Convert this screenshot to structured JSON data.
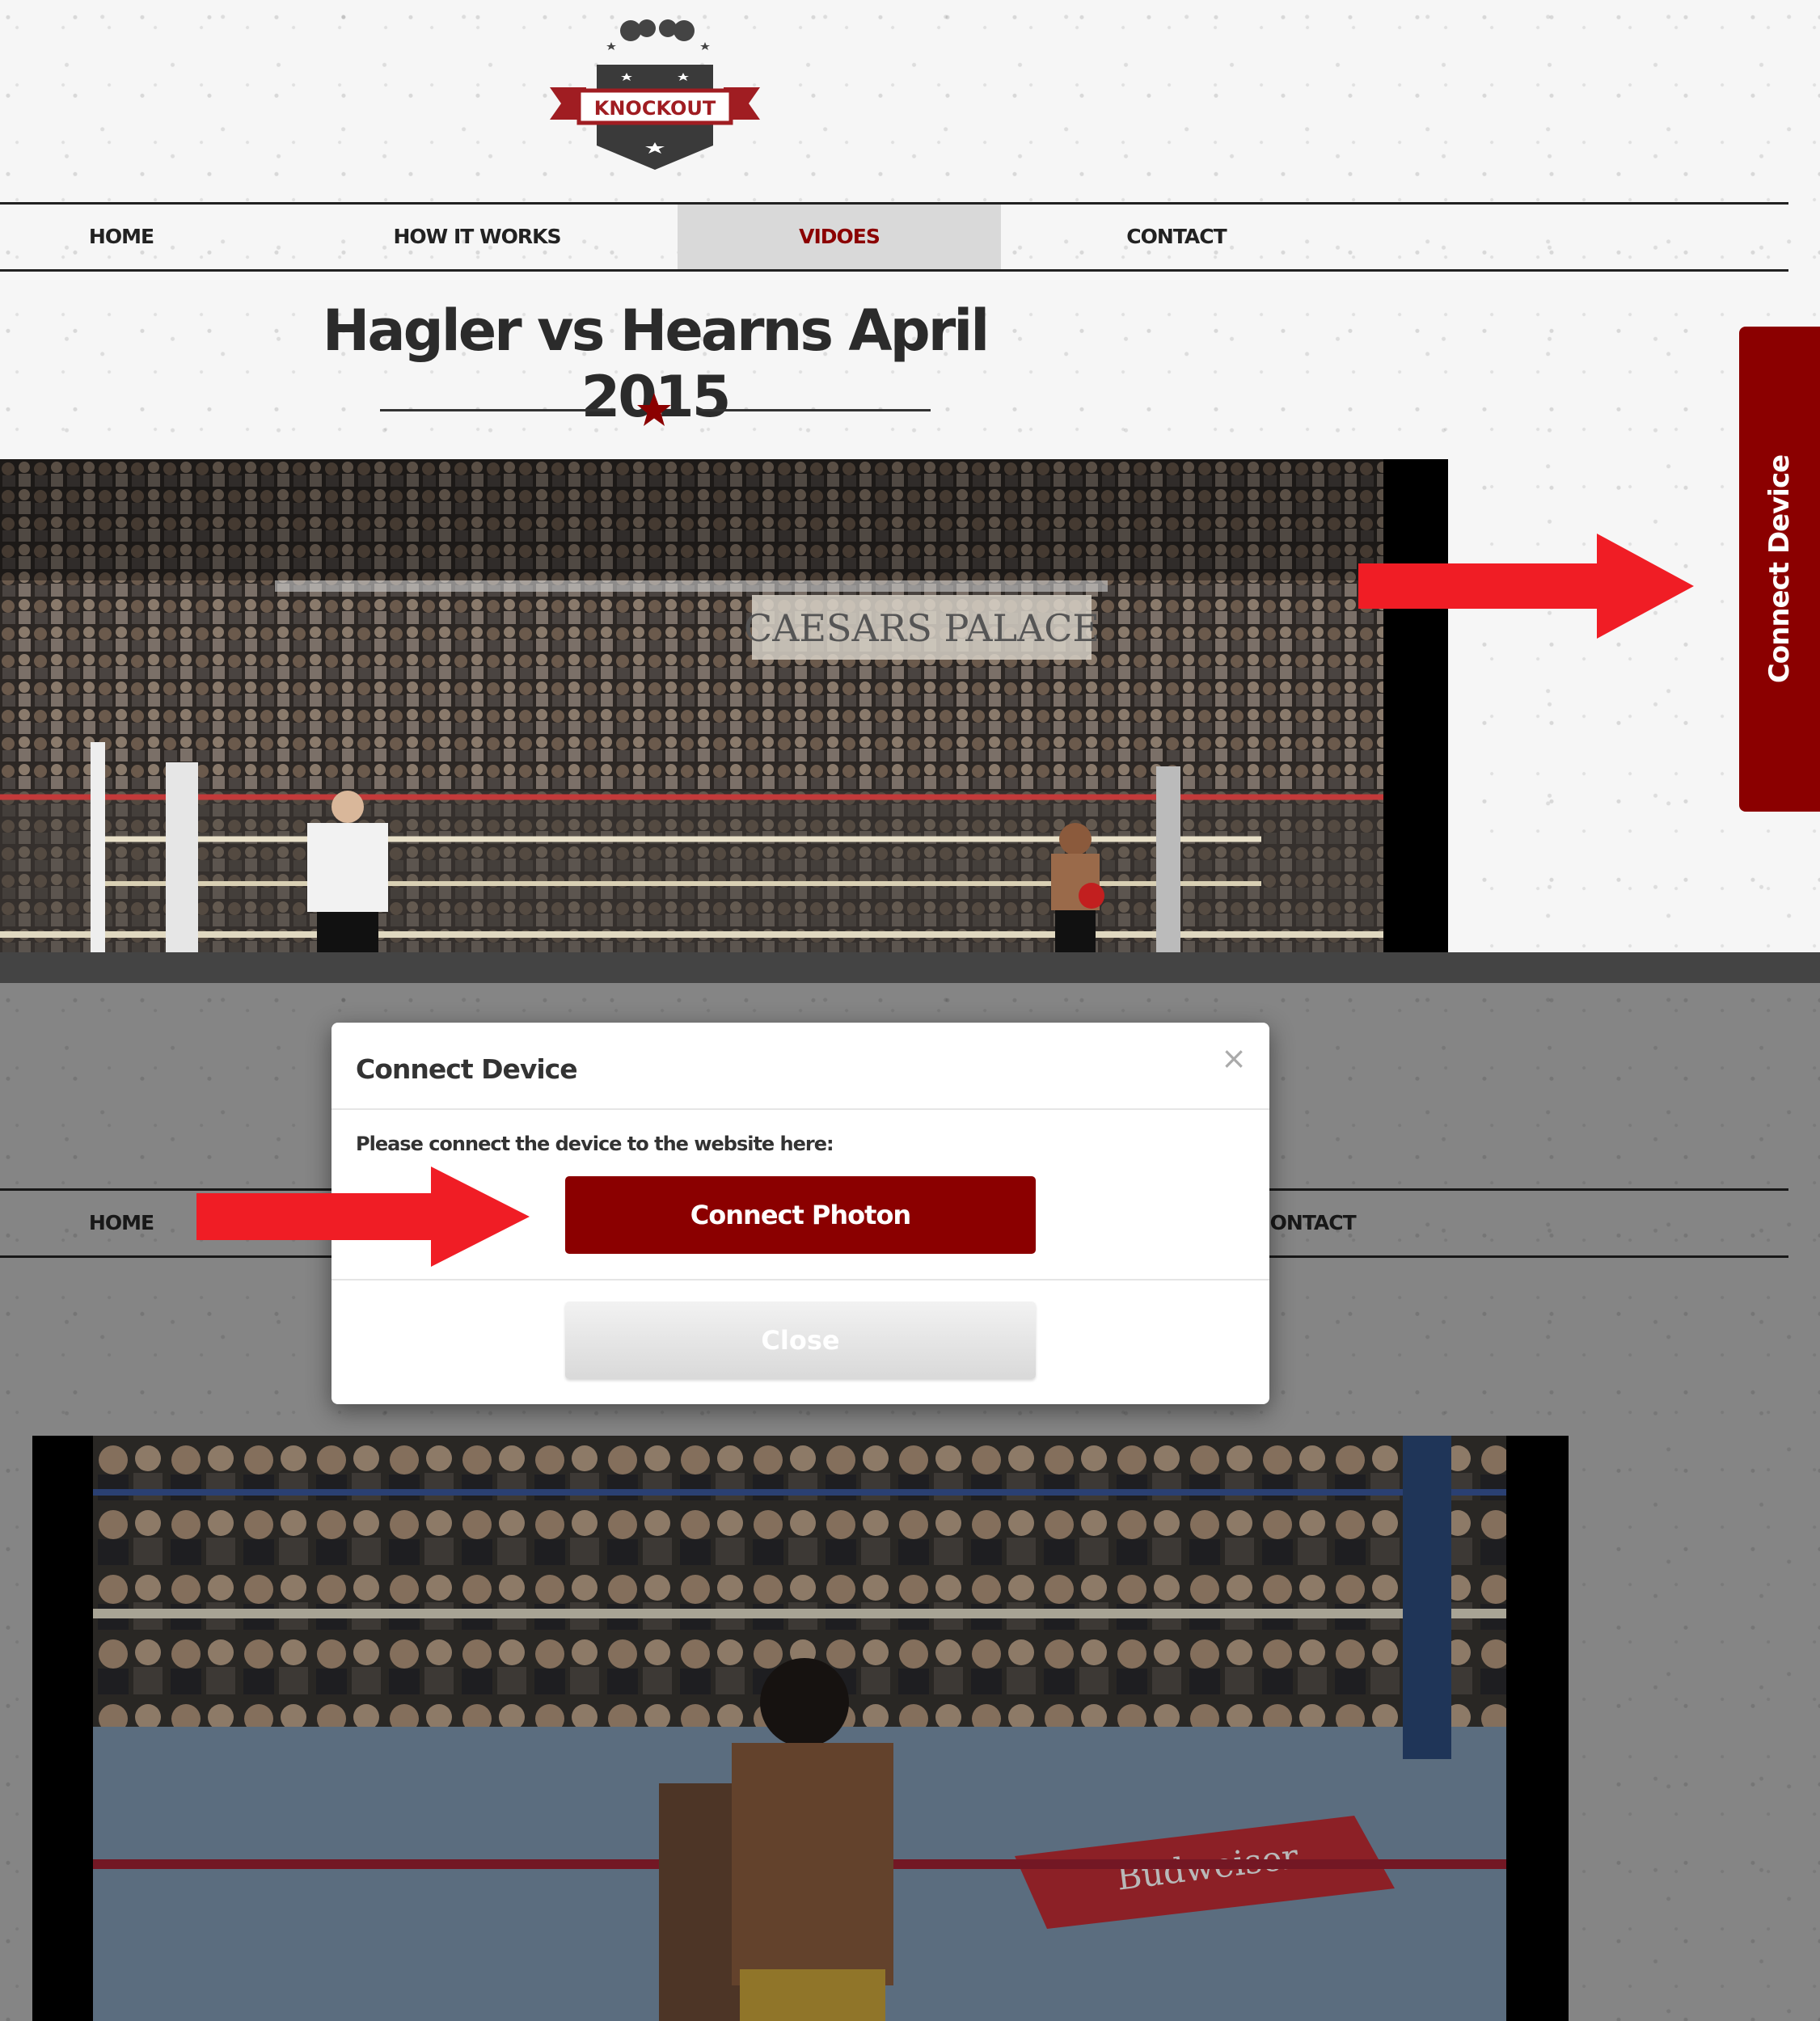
{
  "brand": {
    "logo_text": "KNOCKOUT",
    "accent_color": "#8b0000",
    "arrow_color": "#f01d25"
  },
  "nav": {
    "items": [
      {
        "label": "HOME",
        "active": false
      },
      {
        "label": "HOW IT WORKS",
        "active": false
      },
      {
        "label": "VIDOES",
        "active": true
      },
      {
        "label": "CONTACT",
        "active": false
      }
    ]
  },
  "page": {
    "title": "Hagler vs Hearns April 2015"
  },
  "side_tab": {
    "label": "Connect Device"
  },
  "video_top": {
    "banner_text": "CAESARS PALACE"
  },
  "video_bottom": {
    "banner_text": "Budweiser"
  },
  "modal": {
    "title": "Connect Device",
    "close_glyph": "×",
    "body_text": "Please connect the device to the website here:",
    "primary_button": "Connect Photon",
    "secondary_button": "Close"
  }
}
